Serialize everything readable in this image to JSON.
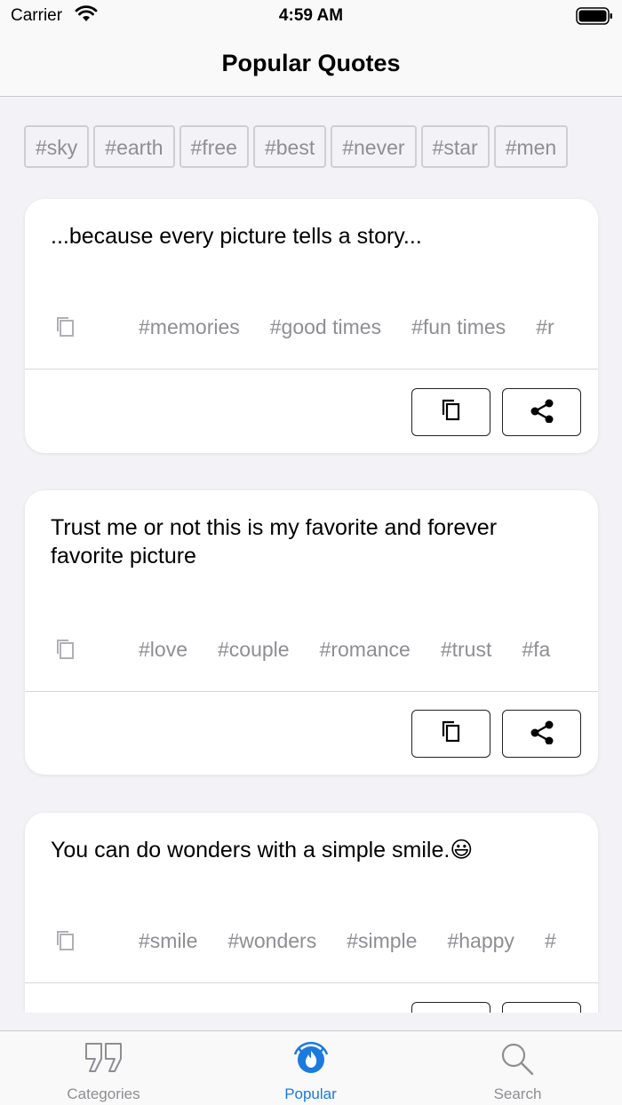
{
  "status_bar": {
    "carrier": "Carrier",
    "time": "4:59 AM"
  },
  "nav": {
    "title": "Popular Quotes"
  },
  "tags": [
    "#sky",
    "#earth",
    "#free",
    "#best",
    "#never",
    "#star",
    "#men"
  ],
  "cards": [
    {
      "quote": "...because every picture tells a story...",
      "tags": [
        "#memories",
        "#good times",
        "#fun times",
        "#r"
      ]
    },
    {
      "quote": "Trust me or not this is my favorite and forever favorite picture",
      "tags": [
        "#love",
        "#couple",
        "#romance",
        "#trust",
        "#fa"
      ]
    },
    {
      "quote": "You can do wonders with a simple smile.😃",
      "tags": [
        "#smile",
        "#wonders",
        "#simple",
        "#happy",
        "#"
      ]
    }
  ],
  "tab_bar": {
    "active": "Popular",
    "accent_color": "#1a7ae0",
    "inactive_color": "#8e8e93",
    "items": [
      {
        "label": "Categories",
        "icon": "quote-icon"
      },
      {
        "label": "Popular",
        "icon": "fire-icon"
      },
      {
        "label": "Search",
        "icon": "search-icon"
      }
    ]
  }
}
